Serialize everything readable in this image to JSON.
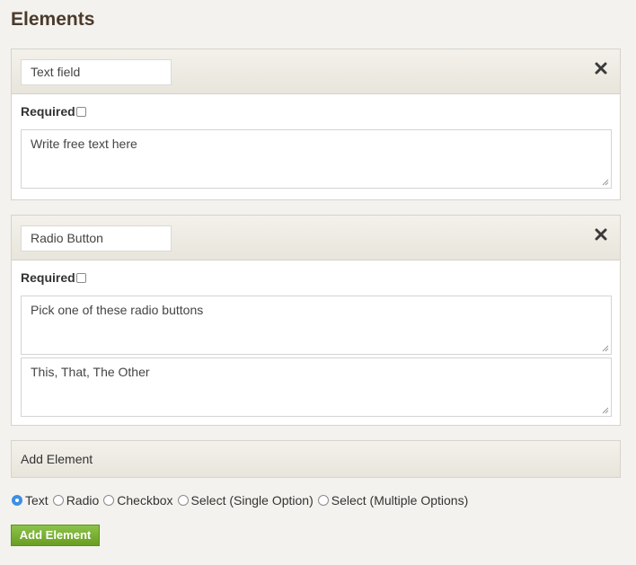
{
  "page": {
    "title": "Elements"
  },
  "elements": [
    {
      "title_value": "Text field",
      "required_label": "Required",
      "required_checked": false,
      "textareas": [
        "Write free text here"
      ]
    },
    {
      "title_value": "Radio Button",
      "required_label": "Required",
      "required_checked": false,
      "textareas": [
        "Pick one of these radio buttons",
        "This, That, The Other"
      ]
    }
  ],
  "add_element": {
    "section_label": "Add Element",
    "types": [
      {
        "label": "Text",
        "selected": true
      },
      {
        "label": "Radio",
        "selected": false
      },
      {
        "label": "Checkbox",
        "selected": false
      },
      {
        "label": "Select (Single Option)",
        "selected": false
      },
      {
        "label": "Select (Multiple Options)",
        "selected": false
      }
    ],
    "button_label": "Add Element"
  },
  "colors": {
    "accent_green": "#76a82a",
    "radio_selected": "#3d8fe3",
    "title_brown": "#4a3b2c"
  }
}
